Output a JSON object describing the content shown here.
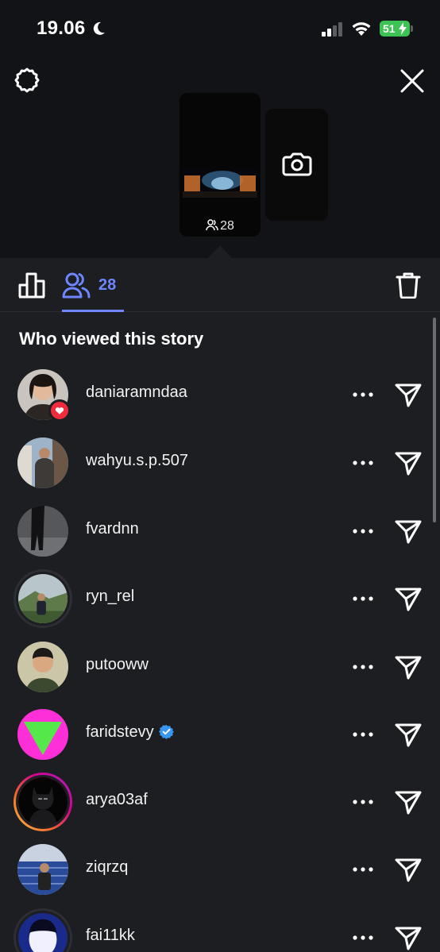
{
  "status_bar": {
    "time": "19.06",
    "battery": "51"
  },
  "story": {
    "view_count": "28"
  },
  "tabs": {
    "viewers_count": "28"
  },
  "section": {
    "title": "Who viewed this story"
  },
  "viewers": [
    {
      "username": "daniaramndaa",
      "liked": true,
      "verified": false
    },
    {
      "username": "wahyu.s.p.507",
      "liked": false,
      "verified": false
    },
    {
      "username": "fvardnn",
      "liked": false,
      "verified": false
    },
    {
      "username": "ryn_rel",
      "liked": false,
      "verified": false
    },
    {
      "username": "putooww",
      "liked": false,
      "verified": false
    },
    {
      "username": "faridstevy",
      "liked": false,
      "verified": true
    },
    {
      "username": "arya03af",
      "liked": false,
      "verified": false
    },
    {
      "username": "ziqrzq",
      "liked": false,
      "verified": false
    },
    {
      "username": "fai11kk",
      "liked": false,
      "verified": false
    }
  ],
  "colors": {
    "accent": "#6e86ff",
    "like": "#ee2c3d",
    "verified": "#3897f0",
    "battery": "#3dc354"
  },
  "icons": [
    "gear-icon",
    "close-icon",
    "camera-icon",
    "bar-chart-icon",
    "viewers-icon",
    "trash-icon",
    "more-icon",
    "send-icon",
    "heart-icon",
    "verified-icon"
  ]
}
